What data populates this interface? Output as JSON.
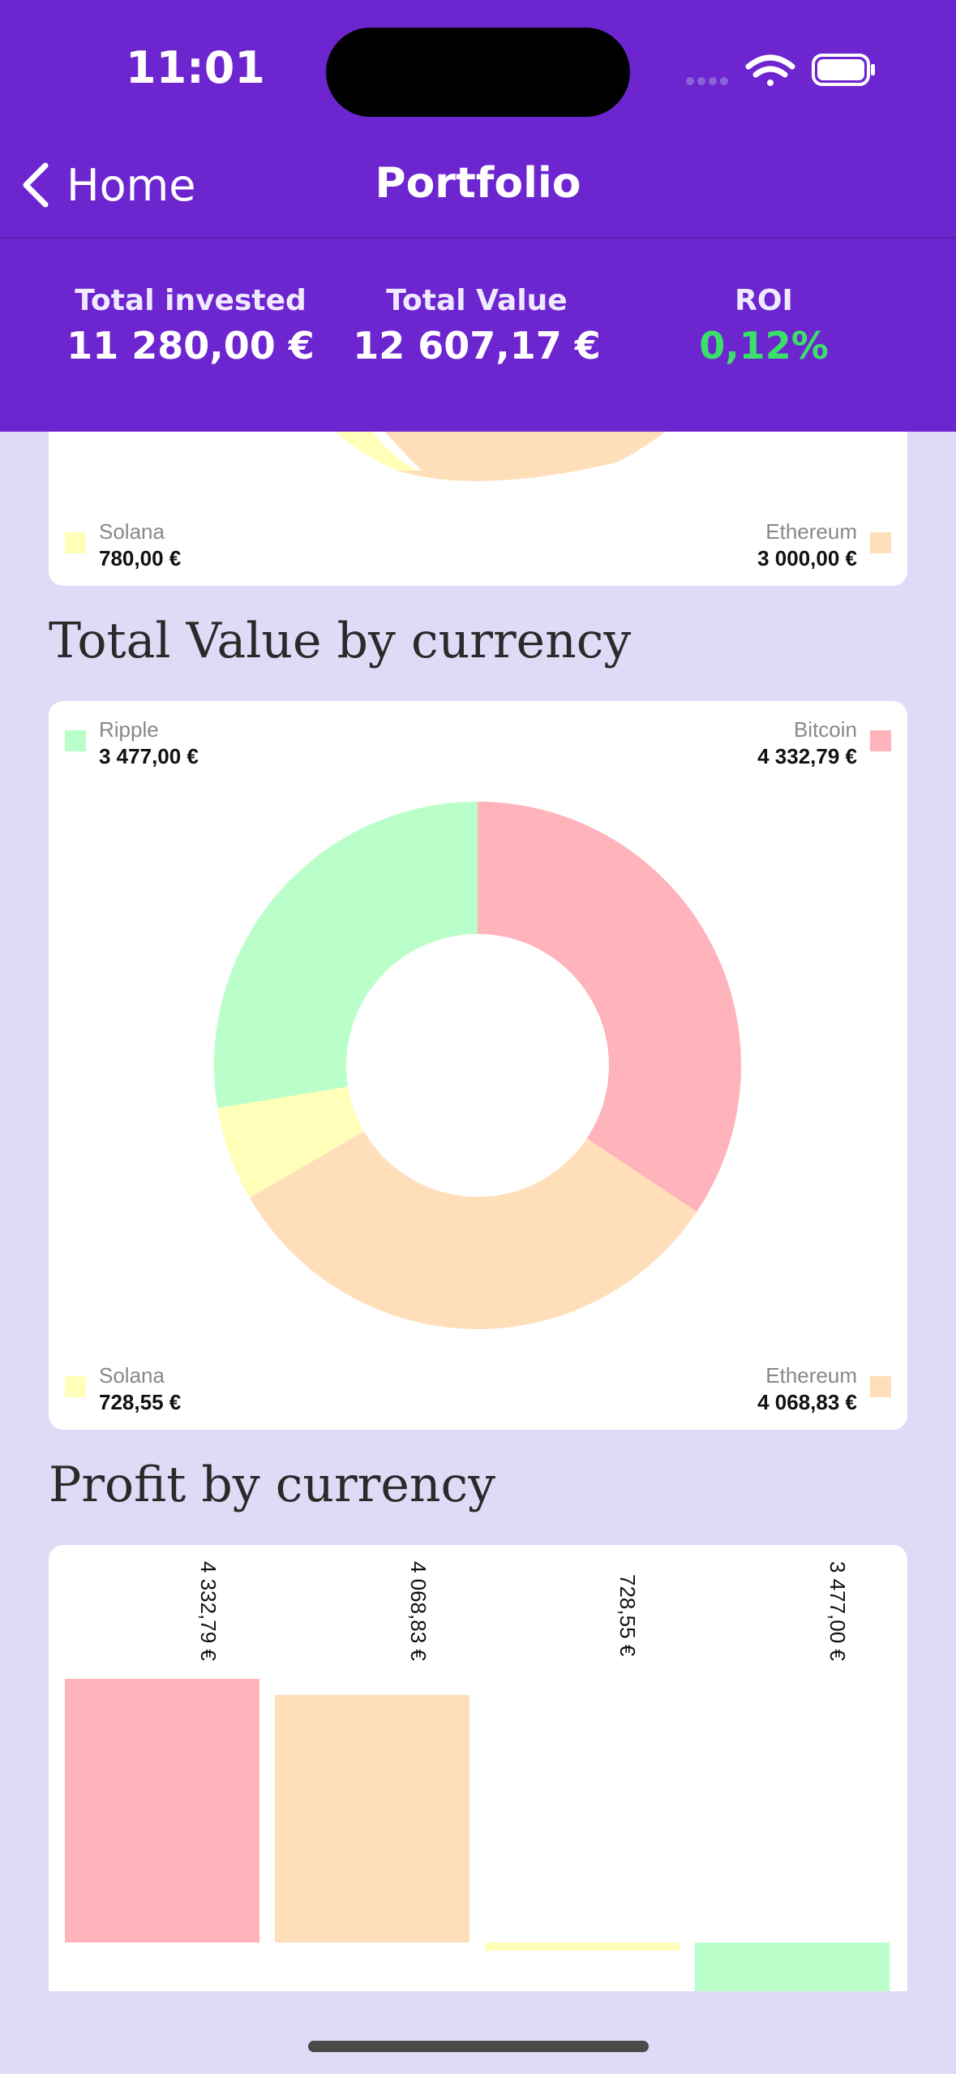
{
  "status_bar": {
    "time": "11:01"
  },
  "nav": {
    "back_label": "Home",
    "title": "Portfolio"
  },
  "summary": {
    "total_invested_label": "Total invested",
    "total_invested_value": "11 280,00 €",
    "total_value_label": "Total Value",
    "total_value_value": "12 607,17 €",
    "roi_label": "ROI",
    "roi_value": "0,12%"
  },
  "colors": {
    "header": "#6d25cf",
    "background": "#e0daf7",
    "bitcoin": "#ffb3ba",
    "ethereum": "#ffdfba",
    "solana": "#ffffba",
    "ripple": "#baffc9",
    "roi_positive": "#3be06a"
  },
  "invested_card": {
    "legend": {
      "solana_name": "Solana",
      "solana_value": "780,00 €",
      "ethereum_name": "Ethereum",
      "ethereum_value": "3 000,00 €"
    }
  },
  "value_section": {
    "title": "Total Value by currency",
    "legend": {
      "ripple_name": "Ripple",
      "ripple_value": "3 477,00 €",
      "bitcoin_name": "Bitcoin",
      "bitcoin_value": "4 332,79 €",
      "solana_name": "Solana",
      "solana_value": "728,55 €",
      "ethereum_name": "Ethereum",
      "ethereum_value": "4 068,83 €"
    }
  },
  "profit_section": {
    "title": "Profit by currency",
    "bar_labels": [
      "4 332,79 €",
      "4 068,83 €",
      "728,55 €",
      "3 477,00 €"
    ]
  },
  "chart_data": [
    {
      "type": "pie",
      "title": "Total Value by currency",
      "categories": [
        "Bitcoin",
        "Ethereum",
        "Solana",
        "Ripple"
      ],
      "values": [
        4332.79,
        4068.83,
        728.55,
        3477.0
      ],
      "colors": [
        "#ffb3ba",
        "#ffdfba",
        "#ffffba",
        "#baffc9"
      ],
      "donut": true
    },
    {
      "type": "bar",
      "title": "Profit by currency",
      "categories": [
        "Bitcoin",
        "Ethereum",
        "Solana",
        "Ripple"
      ],
      "values": [
        4332.79,
        4068.83,
        -51.45,
        -1122.0
      ],
      "value_labels": [
        "4 332,79 €",
        "4 068,83 €",
        "728,55 €",
        "3 477,00 €"
      ],
      "colors": [
        "#ffb3ba",
        "#ffdfba",
        "#ffffba",
        "#baffc9"
      ]
    }
  ]
}
